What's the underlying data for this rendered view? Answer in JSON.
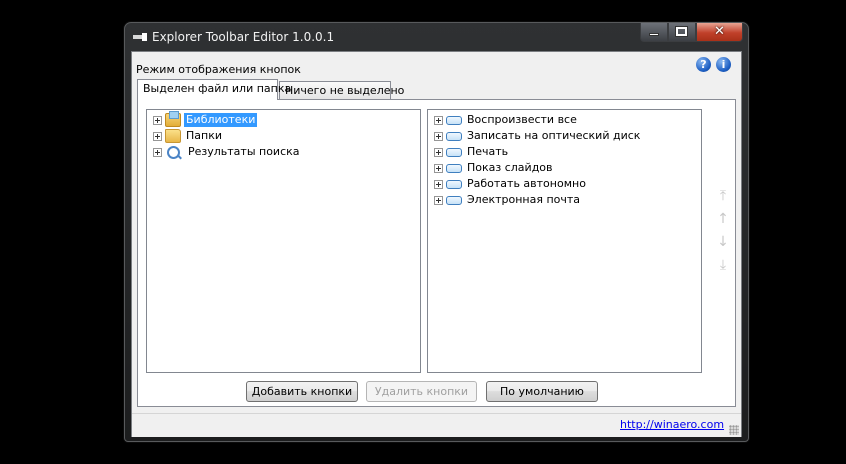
{
  "window": {
    "title": "Explorer Toolbar Editor 1.0.0.1",
    "caption_buttons": {
      "minimize": "minimize",
      "maximize": "maximize",
      "close": "✕"
    }
  },
  "header": {
    "mode_label": "Режим отображения кнопок",
    "help_glyph": "?",
    "info_glyph": "i"
  },
  "tabs": [
    {
      "label": "Выделен файл или папка",
      "active": true
    },
    {
      "label": "Ничего не выделено",
      "active": false
    }
  ],
  "left_tree": {
    "items": [
      {
        "label": "Библиотеки",
        "icon": "libraries-icon",
        "selected": true
      },
      {
        "label": "Папки",
        "icon": "folder-icon",
        "selected": false
      },
      {
        "label": "Результаты поиска",
        "icon": "search-results-icon",
        "selected": false
      }
    ]
  },
  "right_tree": {
    "items": [
      {
        "label": "Воспроизвести все"
      },
      {
        "label": "Записать на оптический диск"
      },
      {
        "label": "Печать"
      },
      {
        "label": "Показ слайдов"
      },
      {
        "label": "Работать автономно"
      },
      {
        "label": "Электронная почта"
      }
    ]
  },
  "order_buttons": {
    "to_top": "⤒",
    "up": "↑",
    "down": "↓",
    "to_bottom": "⤓"
  },
  "buttons": {
    "add": "Добавить кнопки",
    "remove": "Удалить кнопки",
    "default": "По умолчанию"
  },
  "status": {
    "link": "http://winaero.com"
  },
  "colors": {
    "selection": "#3399ff",
    "link": "#0000ee",
    "close_button": "#c0402a"
  }
}
